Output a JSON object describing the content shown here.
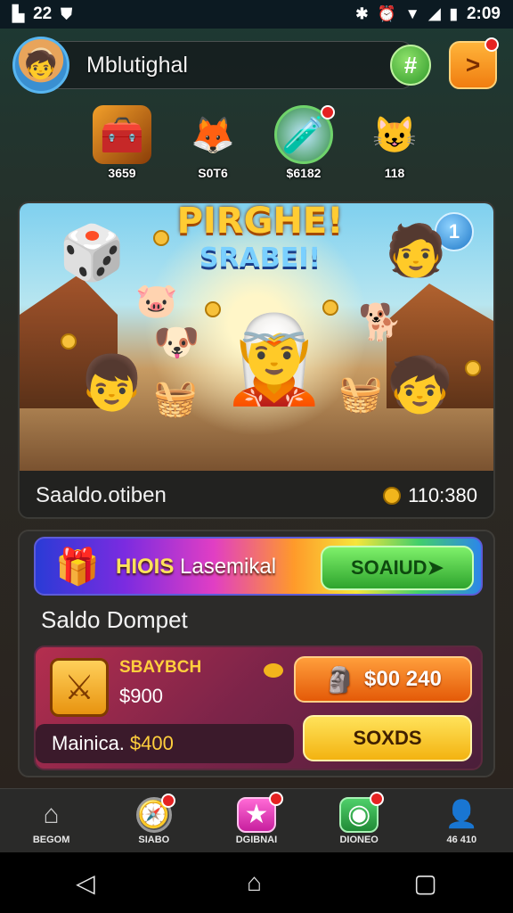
{
  "status_bar": {
    "left_text": "22",
    "time": "2:09",
    "icons": [
      "gallery-icon",
      "shield-icon",
      "bluetooth-icon",
      "alarm-icon",
      "wifi-icon",
      "signal-icon",
      "battery-icon"
    ]
  },
  "header": {
    "username": "Mblutighal",
    "hash_button": "#",
    "next_button": ">"
  },
  "top_items": [
    {
      "label": "3659",
      "icon": "treasure-chest-icon"
    },
    {
      "label": "S0T6",
      "icon": "fox-character-icon"
    },
    {
      "label": "$6182",
      "icon": "potion-icon"
    },
    {
      "label": "118",
      "icon": "cat-kid-icon"
    }
  ],
  "hero": {
    "title": "PIRGHE!",
    "subtitle": "SRABEI!",
    "info_button": "1",
    "footer_label": "Saaldo.otiben",
    "footer_balance": "110:380"
  },
  "wallet": {
    "promo_bold": "HIOIS",
    "promo_text": "Lasemikal",
    "promo_button": "SOAIUD",
    "title": "Saldo Dompet",
    "card_heading": "SBAYBCH",
    "card_amount": "$900",
    "button_primary": "$00 240",
    "button_secondary": "SOXDS",
    "footer_label": "Mainica.",
    "footer_amount": "$400"
  },
  "bottom_nav": [
    {
      "label": "BEGOM",
      "icon": "home-icon"
    },
    {
      "label": "SIABO",
      "icon": "compass-icon"
    },
    {
      "label": "DGIBNAI",
      "icon": "star-icon"
    },
    {
      "label": "DIONEO",
      "icon": "camera-icon"
    },
    {
      "label": "46 410",
      "icon": "profile-icon"
    }
  ],
  "colors": {
    "accent_gold": "#ffcf3d",
    "promo_green": "#2ea42d",
    "card_red": "#b42e4e",
    "nav_bg": "#2a2a29"
  }
}
